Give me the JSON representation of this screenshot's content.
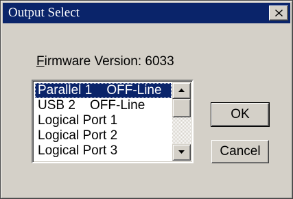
{
  "window": {
    "title": "Output Select",
    "close_icon": "close-icon"
  },
  "firmware": {
    "label_accel": "F",
    "label_rest": "irmware Version: 6033"
  },
  "port_list": {
    "items": [
      {
        "label": "Parallel 1    OFF-Line",
        "selected": true
      },
      {
        "label": "USB 2    OFF-Line",
        "selected": false
      },
      {
        "label": "Logical Port 1",
        "selected": false
      },
      {
        "label": "Logical Port 2",
        "selected": false
      },
      {
        "label": "Logical Port 3",
        "selected": false
      }
    ],
    "scroll_up_icon": "arrow-up-icon",
    "scroll_down_icon": "arrow-down-icon"
  },
  "buttons": {
    "ok_label": "OK",
    "cancel_label": "Cancel"
  },
  "colors": {
    "title_bar": "#0a246a",
    "selection": "#0a246a",
    "face": "#d4d0c8"
  }
}
